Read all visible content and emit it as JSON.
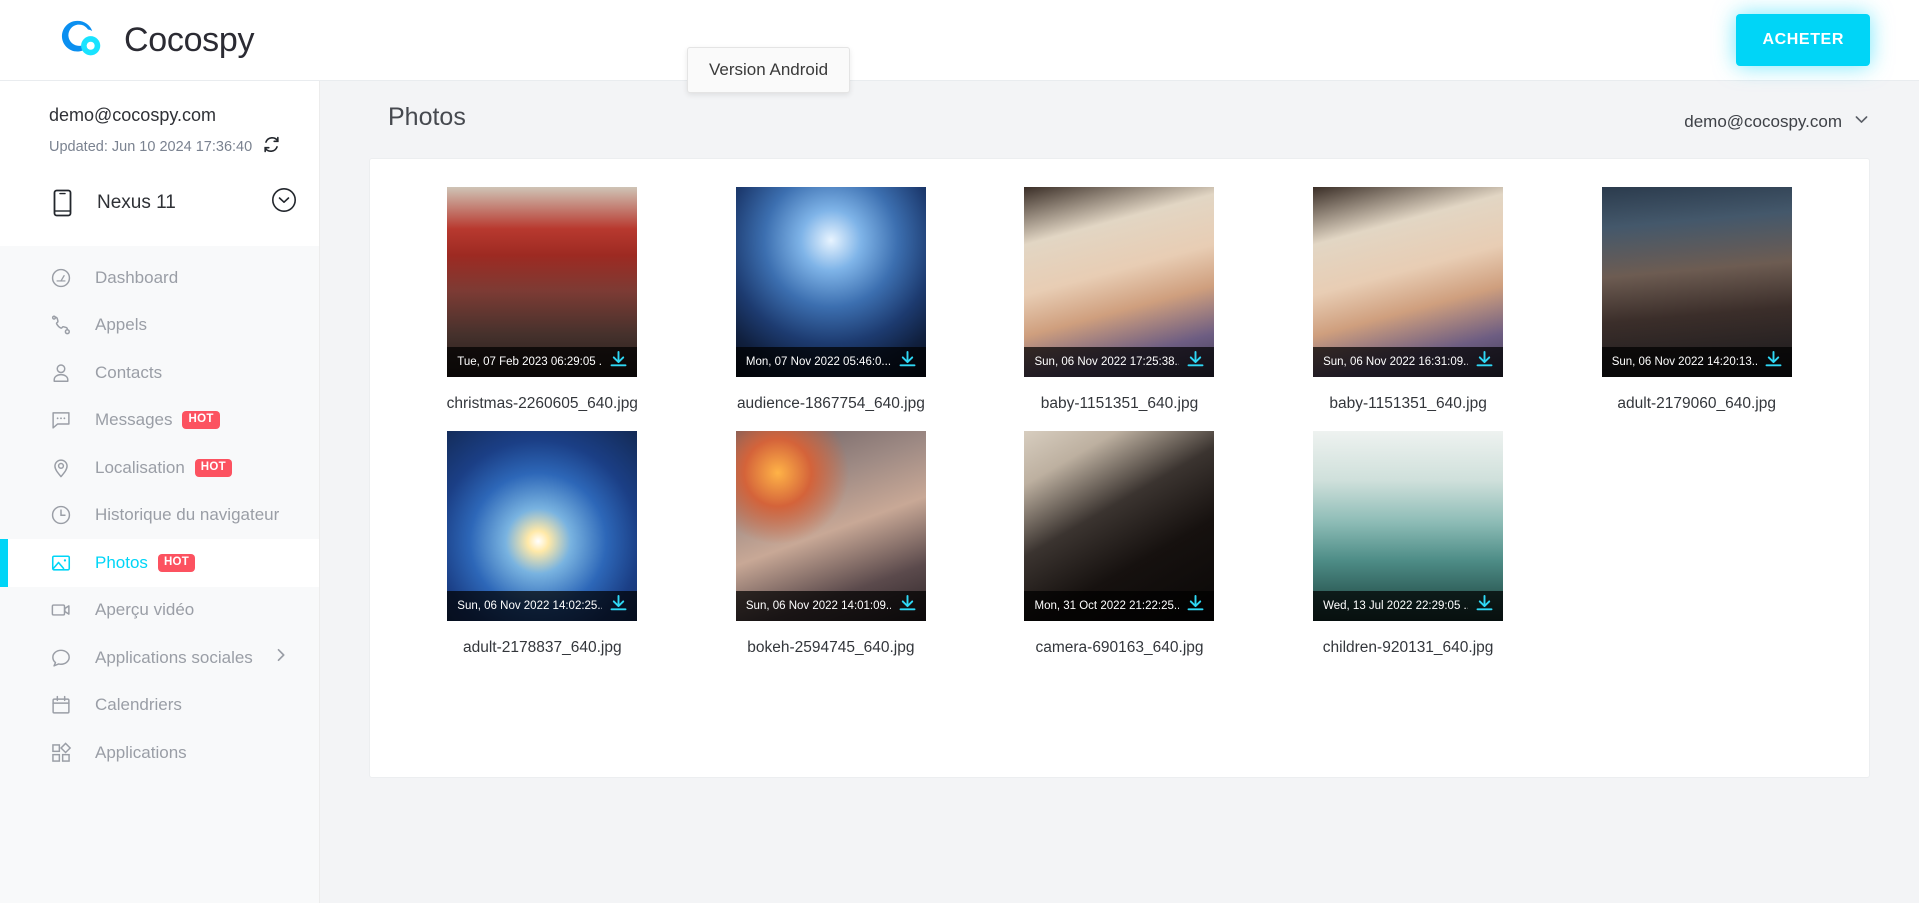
{
  "brand": {
    "name": "Cocospy",
    "logo_icon": "cocospy-logo",
    "accent_color": "#00d5f7"
  },
  "topbar": {
    "buy_label": "ACHETER",
    "tooltip_text": "Version Android"
  },
  "sidebar": {
    "account_email": "demo@cocospy.com",
    "updated_text": "Updated: Jun 10 2024 17:36:40",
    "refresh_icon": "refresh-icon",
    "device": {
      "name": "Nexus 11",
      "icon": "phone-icon",
      "caret_icon": "chevron-down-circle-icon"
    },
    "items": [
      {
        "label": "Dashboard",
        "icon": "speedometer-icon",
        "badge": "",
        "active": false,
        "chevron": false
      },
      {
        "label": "Appels",
        "icon": "phone-call-icon",
        "badge": "",
        "active": false,
        "chevron": false
      },
      {
        "label": "Contacts",
        "icon": "user-icon",
        "badge": "",
        "active": false,
        "chevron": false
      },
      {
        "label": "Messages",
        "icon": "chat-bubble-icon",
        "badge": "HOT",
        "active": false,
        "chevron": false
      },
      {
        "label": "Localisation",
        "icon": "map-pin-icon",
        "badge": "HOT",
        "active": false,
        "chevron": false
      },
      {
        "label": "Historique du navigateur",
        "icon": "clock-icon",
        "badge": "",
        "active": false,
        "chevron": false
      },
      {
        "label": "Photos",
        "icon": "image-icon",
        "badge": "HOT",
        "active": true,
        "chevron": false
      },
      {
        "label": "Aperçu vidéo",
        "icon": "video-camera-icon",
        "badge": "",
        "active": false,
        "chevron": false
      },
      {
        "label": "Applications sociales",
        "icon": "speech-bubble-icon",
        "badge": "",
        "active": false,
        "chevron": true
      },
      {
        "label": "Calendriers",
        "icon": "calendar-icon",
        "badge": "",
        "active": false,
        "chevron": false
      },
      {
        "label": "Applications",
        "icon": "apps-grid-icon",
        "badge": "",
        "active": false,
        "chevron": false
      }
    ]
  },
  "main": {
    "title": "Photos",
    "account_menu": {
      "label": "demo@cocospy.com",
      "caret_icon": "chevron-down-icon"
    },
    "photos": [
      {
        "filename": "christmas-2260605_640.jpg",
        "timestamp": "Tue, 07 Feb 2023 06:29:05 ...",
        "theme": "christmas"
      },
      {
        "filename": "audience-1867754_640.jpg",
        "timestamp": "Mon, 07 Nov 2022 05:46:0...",
        "theme": "concert"
      },
      {
        "filename": "baby-1151351_640.jpg",
        "timestamp": "Sun, 06 Nov 2022 17:25:38...",
        "theme": "baby"
      },
      {
        "filename": "baby-1151351_640.jpg",
        "timestamp": "Sun, 06 Nov 2022 16:31:09...",
        "theme": "baby"
      },
      {
        "filename": "adult-2179060_640.jpg",
        "timestamp": "Sun, 06 Nov 2022 14:20:13...",
        "theme": "portrait"
      },
      {
        "filename": "adult-2178837_640.jpg",
        "timestamp": "Sun, 06 Nov 2022 14:02:25...",
        "theme": "sparkler"
      },
      {
        "filename": "bokeh-2594745_640.jpg",
        "timestamp": "Sun, 06 Nov 2022 14:01:09...",
        "theme": "bokeh"
      },
      {
        "filename": "camera-690163_640.jpg",
        "timestamp": "Mon, 31 Oct 2022 21:22:25...",
        "theme": "camera"
      },
      {
        "filename": "children-920131_640.jpg",
        "timestamp": "Wed, 13 Jul 2022 22:29:05 ...",
        "theme": "children"
      }
    ],
    "download_icon": "download-icon"
  }
}
